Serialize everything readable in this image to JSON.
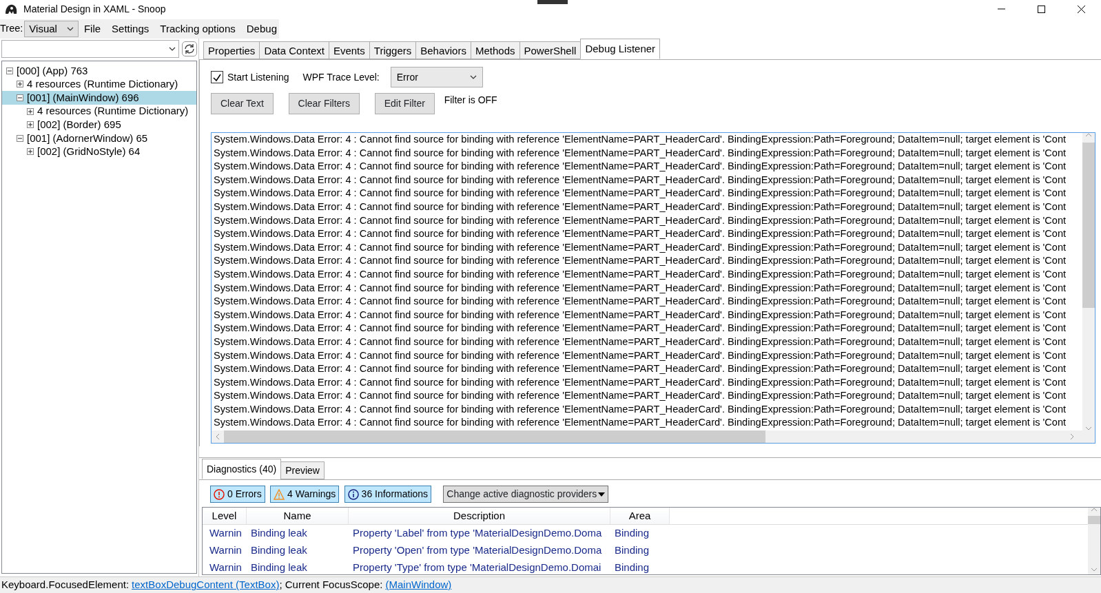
{
  "window": {
    "title": "Material Design in XAML - Snoop"
  },
  "toolbar": {
    "tree_label": "Tree:",
    "tree_mode": "Visual",
    "menu": [
      "File",
      "Settings",
      "Tracking options",
      "Debug"
    ]
  },
  "tree": [
    {
      "label": "[000]  (App) 763",
      "expanded": true,
      "selected": false,
      "children": [
        {
          "label": "4 resources (Runtime Dictionary)",
          "expanded": false,
          "selected": false
        },
        {
          "label": "[001]  (MainWindow) 696",
          "expanded": true,
          "selected": true,
          "children": [
            {
              "label": "4 resources (Runtime Dictionary)",
              "expanded": false,
              "selected": false
            },
            {
              "label": "[002]  (Border) 695",
              "expanded": false,
              "selected": false
            }
          ]
        },
        {
          "label": "[001]  (AdornerWindow) 65",
          "expanded": true,
          "selected": false,
          "children": [
            {
              "label": "[002]  (GridNoStyle) 64",
              "expanded": false,
              "selected": false
            }
          ]
        }
      ]
    }
  ],
  "tabs": [
    {
      "label": "Properties",
      "selected": false
    },
    {
      "label": "Data Context",
      "selected": false
    },
    {
      "label": "Events",
      "selected": false
    },
    {
      "label": "Triggers",
      "selected": false
    },
    {
      "label": "Behaviors",
      "selected": false
    },
    {
      "label": "Methods",
      "selected": false
    },
    {
      "label": "PowerShell",
      "selected": false
    },
    {
      "label": "Debug Listener",
      "selected": true
    }
  ],
  "debug_listener": {
    "start_listening": {
      "label": "Start Listening",
      "checked": true
    },
    "trace_level": {
      "label": "WPF Trace Level:",
      "value": "Error"
    },
    "buttons": [
      "Clear Text",
      "Clear Filters",
      "Edit Filter"
    ],
    "filter_status": "Filter is OFF",
    "log": [
      "System.Windows.Data Error: 4 : Cannot find source for binding with reference 'ElementName=PART_HeaderCard'. BindingExpression:Path=Foreground; DataItem=null; target element is 'Cont",
      "System.Windows.Data Error: 4 : Cannot find source for binding with reference 'ElementName=PART_HeaderCard'. BindingExpression:Path=Foreground; DataItem=null; target element is 'Cont",
      "System.Windows.Data Error: 4 : Cannot find source for binding with reference 'ElementName=PART_HeaderCard'. BindingExpression:Path=Foreground; DataItem=null; target element is 'Cont",
      "System.Windows.Data Error: 4 : Cannot find source for binding with reference 'ElementName=PART_HeaderCard'. BindingExpression:Path=Foreground; DataItem=null; target element is 'Cont",
      "System.Windows.Data Error: 4 : Cannot find source for binding with reference 'ElementName=PART_HeaderCard'. BindingExpression:Path=Foreground; DataItem=null; target element is 'Cont",
      "System.Windows.Data Error: 4 : Cannot find source for binding with reference 'ElementName=PART_HeaderCard'. BindingExpression:Path=Foreground; DataItem=null; target element is 'Cont",
      "System.Windows.Data Error: 4 : Cannot find source for binding with reference 'ElementName=PART_HeaderCard'. BindingExpression:Path=Foreground; DataItem=null; target element is 'Cont",
      "System.Windows.Data Error: 4 : Cannot find source for binding with reference 'ElementName=PART_HeaderCard'. BindingExpression:Path=Foreground; DataItem=null; target element is 'Cont",
      "System.Windows.Data Error: 4 : Cannot find source for binding with reference 'ElementName=PART_HeaderCard'. BindingExpression:Path=Foreground; DataItem=null; target element is 'Cont",
      "System.Windows.Data Error: 4 : Cannot find source for binding with reference 'ElementName=PART_HeaderCard'. BindingExpression:Path=Foreground; DataItem=null; target element is 'Cont",
      "System.Windows.Data Error: 4 : Cannot find source for binding with reference 'ElementName=PART_HeaderCard'. BindingExpression:Path=Foreground; DataItem=null; target element is 'Cont",
      "System.Windows.Data Error: 4 : Cannot find source for binding with reference 'ElementName=PART_HeaderCard'. BindingExpression:Path=Foreground; DataItem=null; target element is 'Cont",
      "System.Windows.Data Error: 4 : Cannot find source for binding with reference 'ElementName=PART_HeaderCard'. BindingExpression:Path=Foreground; DataItem=null; target element is 'Cont",
      "System.Windows.Data Error: 4 : Cannot find source for binding with reference 'ElementName=PART_HeaderCard'. BindingExpression:Path=Foreground; DataItem=null; target element is 'Cont",
      "System.Windows.Data Error: 4 : Cannot find source for binding with reference 'ElementName=PART_HeaderCard'. BindingExpression:Path=Foreground; DataItem=null; target element is 'Cont",
      "System.Windows.Data Error: 4 : Cannot find source for binding with reference 'ElementName=PART_HeaderCard'. BindingExpression:Path=Foreground; DataItem=null; target element is 'Cont",
      "System.Windows.Data Error: 4 : Cannot find source for binding with reference 'ElementName=PART_HeaderCard'. BindingExpression:Path=Foreground; DataItem=null; target element is 'Cont",
      "System.Windows.Data Error: 4 : Cannot find source for binding with reference 'ElementName=PART_HeaderCard'. BindingExpression:Path=Foreground; DataItem=null; target element is 'Cont",
      "System.Windows.Data Error: 4 : Cannot find source for binding with reference 'ElementName=PART_HeaderCard'. BindingExpression:Path=Foreground; DataItem=null; target element is 'Cont",
      "System.Windows.Data Error: 4 : Cannot find source for binding with reference 'ElementName=PART_HeaderCard'. BindingExpression:Path=Foreground; DataItem=null; target element is 'Cont",
      "System.Windows.Data Error: 4 : Cannot find source for binding with reference 'ElementName=PART_HeaderCard'. BindingExpression:Path=Foreground; DataItem=null; target element is 'Cont",
      "System.Windows.Data Error: 4 : Cannot find source for binding with reference 'ElementName=PART_HeaderCard'. BindingExpression:Path=Foreground; DataItem=null; target element is 'Cont"
    ]
  },
  "diagnostics": {
    "tabs": [
      {
        "label": "Diagnostics (40)",
        "selected": true
      },
      {
        "label": "Preview",
        "selected": false
      }
    ],
    "filters": [
      {
        "kind": "error",
        "label": "0 Errors",
        "on": true
      },
      {
        "kind": "warning",
        "label": "4 Warnings",
        "on": true
      },
      {
        "kind": "info",
        "label": "36 Informations",
        "on": true
      }
    ],
    "providers_button": "Change active diagnostic providers",
    "columns": [
      "Level",
      "Name",
      "Description",
      "Area"
    ],
    "rows": [
      [
        "Warnin",
        "Binding leak",
        "Property 'Label' from type 'MaterialDesignDemo.Doma",
        "Binding"
      ],
      [
        "Warnin",
        "Binding leak",
        "Property 'Open' from type 'MaterialDesignDemo.Doma",
        "Binding"
      ],
      [
        "Warnin",
        "Binding leak",
        "Property 'Type' from type 'MaterialDesignDemo.Domai",
        "Binding"
      ]
    ]
  },
  "status_bar": [
    {
      "kind": "text",
      "text": "Keyboard.FocusedElement:"
    },
    {
      "kind": "link",
      "text": "textBoxDebugContent (TextBox)"
    },
    {
      "kind": "text",
      "text": "; Current FocusScope:"
    },
    {
      "kind": "link",
      "text": "(MainWindow)"
    }
  ]
}
